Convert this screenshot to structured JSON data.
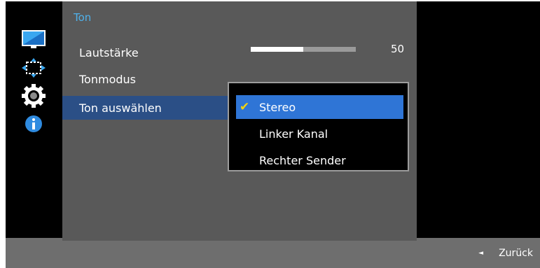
{
  "panel": {
    "title": "Ton"
  },
  "menu": {
    "items": [
      {
        "label": "Lautstärke"
      },
      {
        "label": "Tonmodus"
      },
      {
        "label": "Ton auswählen"
      }
    ],
    "selected_index": 2
  },
  "volume": {
    "value": "50",
    "level_percent": 50
  },
  "dropdown": {
    "options": [
      {
        "label": "Stereo",
        "selected": true
      },
      {
        "label": "Linker Kanal",
        "selected": false
      },
      {
        "label": "Rechter Sender",
        "selected": false
      }
    ]
  },
  "footer": {
    "back_label": "Zurück"
  },
  "icons": [
    "monitor-icon",
    "resize-arrows-icon",
    "gear-icon",
    "info-icon"
  ],
  "colors": {
    "panel_title": "#4fb1ea",
    "selected_row": "#2b4f86",
    "dropdown_highlight": "#2f75d6",
    "checkmark": "#f2d20f"
  }
}
